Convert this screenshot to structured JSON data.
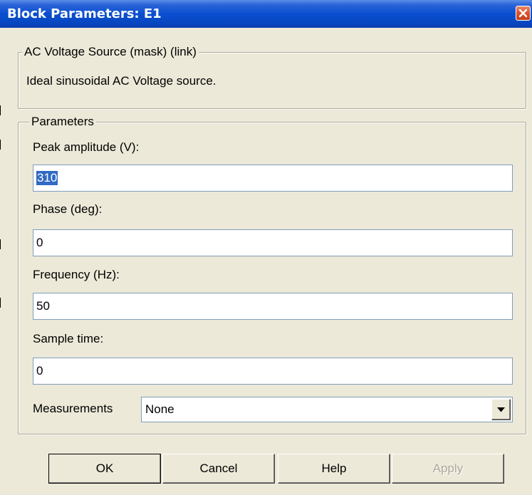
{
  "window": {
    "title": "Block Parameters: E1"
  },
  "description_group": {
    "legend": "AC Voltage Source (mask) (link)",
    "text": "Ideal sinusoidal AC Voltage source."
  },
  "parameters": {
    "legend": "Parameters",
    "peak_amplitude": {
      "label": "Peak amplitude (V):",
      "value": "310"
    },
    "phase": {
      "label": "Phase (deg):",
      "value": "0"
    },
    "frequency": {
      "label": "Frequency (Hz):",
      "value": "50"
    },
    "sample_time": {
      "label": "Sample time:",
      "value": "0"
    },
    "measurements": {
      "label": "Measurements",
      "value": "None"
    }
  },
  "buttons": {
    "ok": "OK",
    "cancel": "Cancel",
    "help": "Help",
    "apply": "Apply"
  },
  "colors": {
    "titlebar": "#0a4fd0",
    "dialog_bg": "#ece9d8",
    "selection": "#316ac5",
    "close": "#d9512b"
  }
}
